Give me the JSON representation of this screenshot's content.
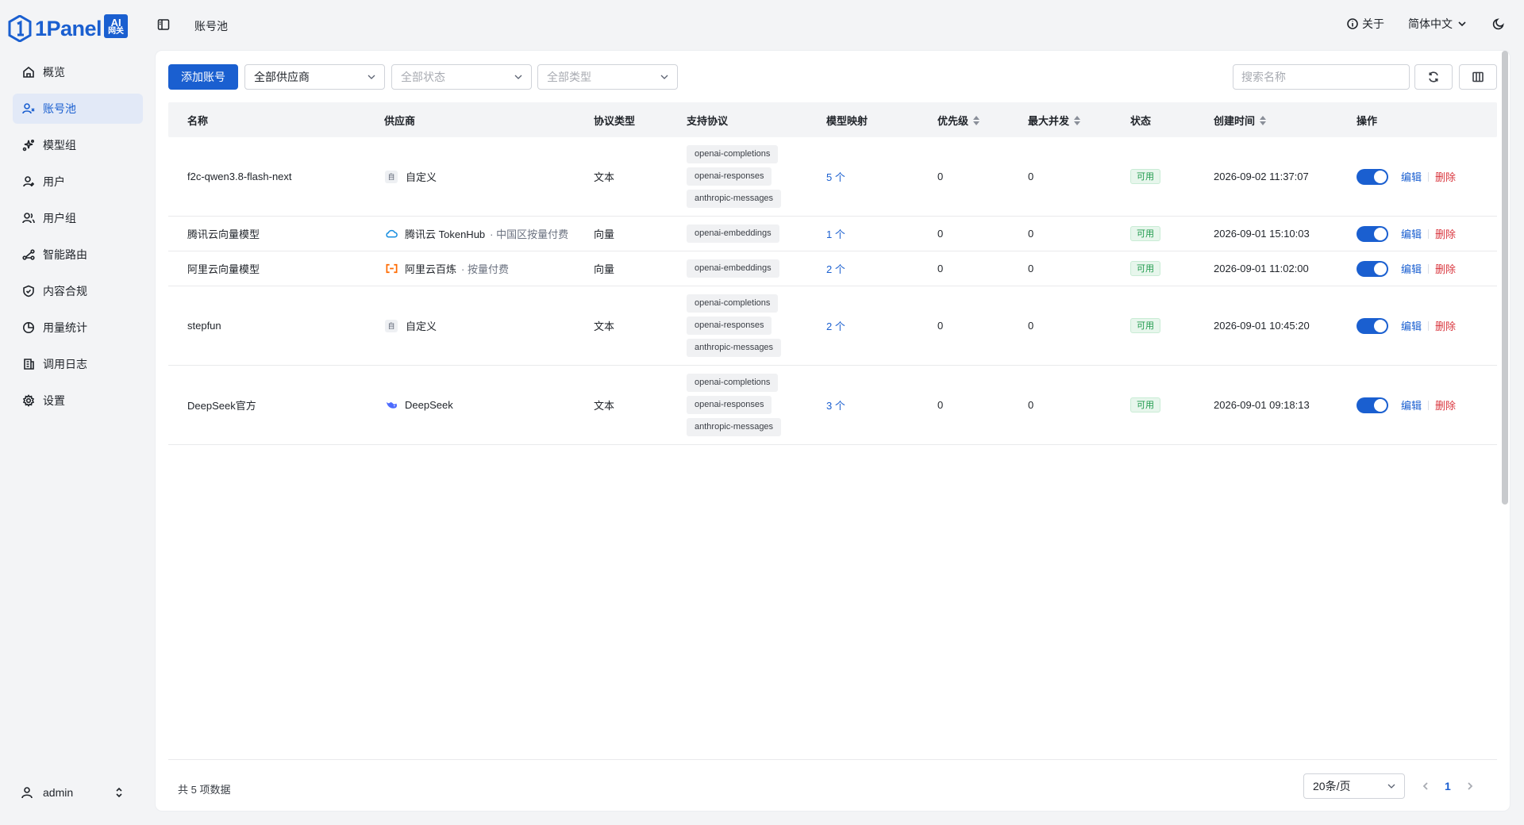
{
  "app": {
    "logo_text": "1Panel",
    "logo_badge_top": "AI",
    "logo_badge_bottom": "网关"
  },
  "sidebar": {
    "items": [
      {
        "label": "概览",
        "icon": "home-icon"
      },
      {
        "label": "账号池",
        "icon": "user-pool-icon",
        "active": true
      },
      {
        "label": "模型组",
        "icon": "model-group-icon"
      },
      {
        "label": "用户",
        "icon": "user-icon"
      },
      {
        "label": "用户组",
        "icon": "user-group-icon"
      },
      {
        "label": "智能路由",
        "icon": "route-icon"
      },
      {
        "label": "内容合规",
        "icon": "shield-icon"
      },
      {
        "label": "用量统计",
        "icon": "pie-chart-icon"
      },
      {
        "label": "调用日志",
        "icon": "log-icon"
      },
      {
        "label": "设置",
        "icon": "gear-icon"
      }
    ],
    "user": "admin"
  },
  "header": {
    "breadcrumb": "账号池",
    "about": "关于",
    "language": "简体中文"
  },
  "toolbar": {
    "add_label": "添加账号",
    "provider_filter": "全部供应商",
    "status_filter": "全部状态",
    "type_filter": "全部类型",
    "search_placeholder": "搜索名称"
  },
  "table": {
    "columns": [
      "名称",
      "供应商",
      "协议类型",
      "支持协议",
      "模型映射",
      "优先级",
      "最大并发",
      "状态",
      "创建时间",
      "操作"
    ],
    "rows": [
      {
        "name": "f2c-qwen3.8-flash-next",
        "provider": "自定义",
        "provider_sub": "",
        "provider_icon": "custom",
        "type": "文本",
        "protocols": [
          "openai-completions",
          "openai-responses",
          "anthropic-messages"
        ],
        "mapping": "5 个",
        "priority": "0",
        "concurrency": "0",
        "status": "可用",
        "created": "2026-09-02 11:37:07"
      },
      {
        "name": "腾讯云向量模型",
        "provider": "腾讯云 TokenHub",
        "provider_sub": "· 中国区按量付费",
        "provider_icon": "tencent",
        "type": "向量",
        "protocols": [
          "openai-embeddings"
        ],
        "mapping": "1 个",
        "priority": "0",
        "concurrency": "0",
        "status": "可用",
        "created": "2026-09-01 15:10:03"
      },
      {
        "name": "阿里云向量模型",
        "provider": "阿里云百炼",
        "provider_sub": "· 按量付费",
        "provider_icon": "aliyun",
        "type": "向量",
        "protocols": [
          "openai-embeddings"
        ],
        "mapping": "2 个",
        "priority": "0",
        "concurrency": "0",
        "status": "可用",
        "created": "2026-09-01 11:02:00"
      },
      {
        "name": "stepfun",
        "provider": "自定义",
        "provider_sub": "",
        "provider_icon": "custom",
        "type": "文本",
        "protocols": [
          "openai-completions",
          "openai-responses",
          "anthropic-messages"
        ],
        "mapping": "2 个",
        "priority": "0",
        "concurrency": "0",
        "status": "可用",
        "created": "2026-09-01 10:45:20"
      },
      {
        "name": "DeepSeek官方",
        "provider": "DeepSeek",
        "provider_sub": "",
        "provider_icon": "deepseek",
        "type": "文本",
        "protocols": [
          "openai-completions",
          "openai-responses",
          "anthropic-messages"
        ],
        "mapping": "3 个",
        "priority": "0",
        "concurrency": "0",
        "status": "可用",
        "created": "2026-09-01 09:18:13"
      }
    ],
    "edit_label": "编辑",
    "delete_label": "删除",
    "custom_icon_char": "自"
  },
  "footer": {
    "total": "共 5 项数据",
    "page_size": "20条/页",
    "current_page": "1"
  },
  "colors": {
    "primary": "#1a5fd0",
    "danger": "#d9363e",
    "success": "#1f9a4c"
  }
}
